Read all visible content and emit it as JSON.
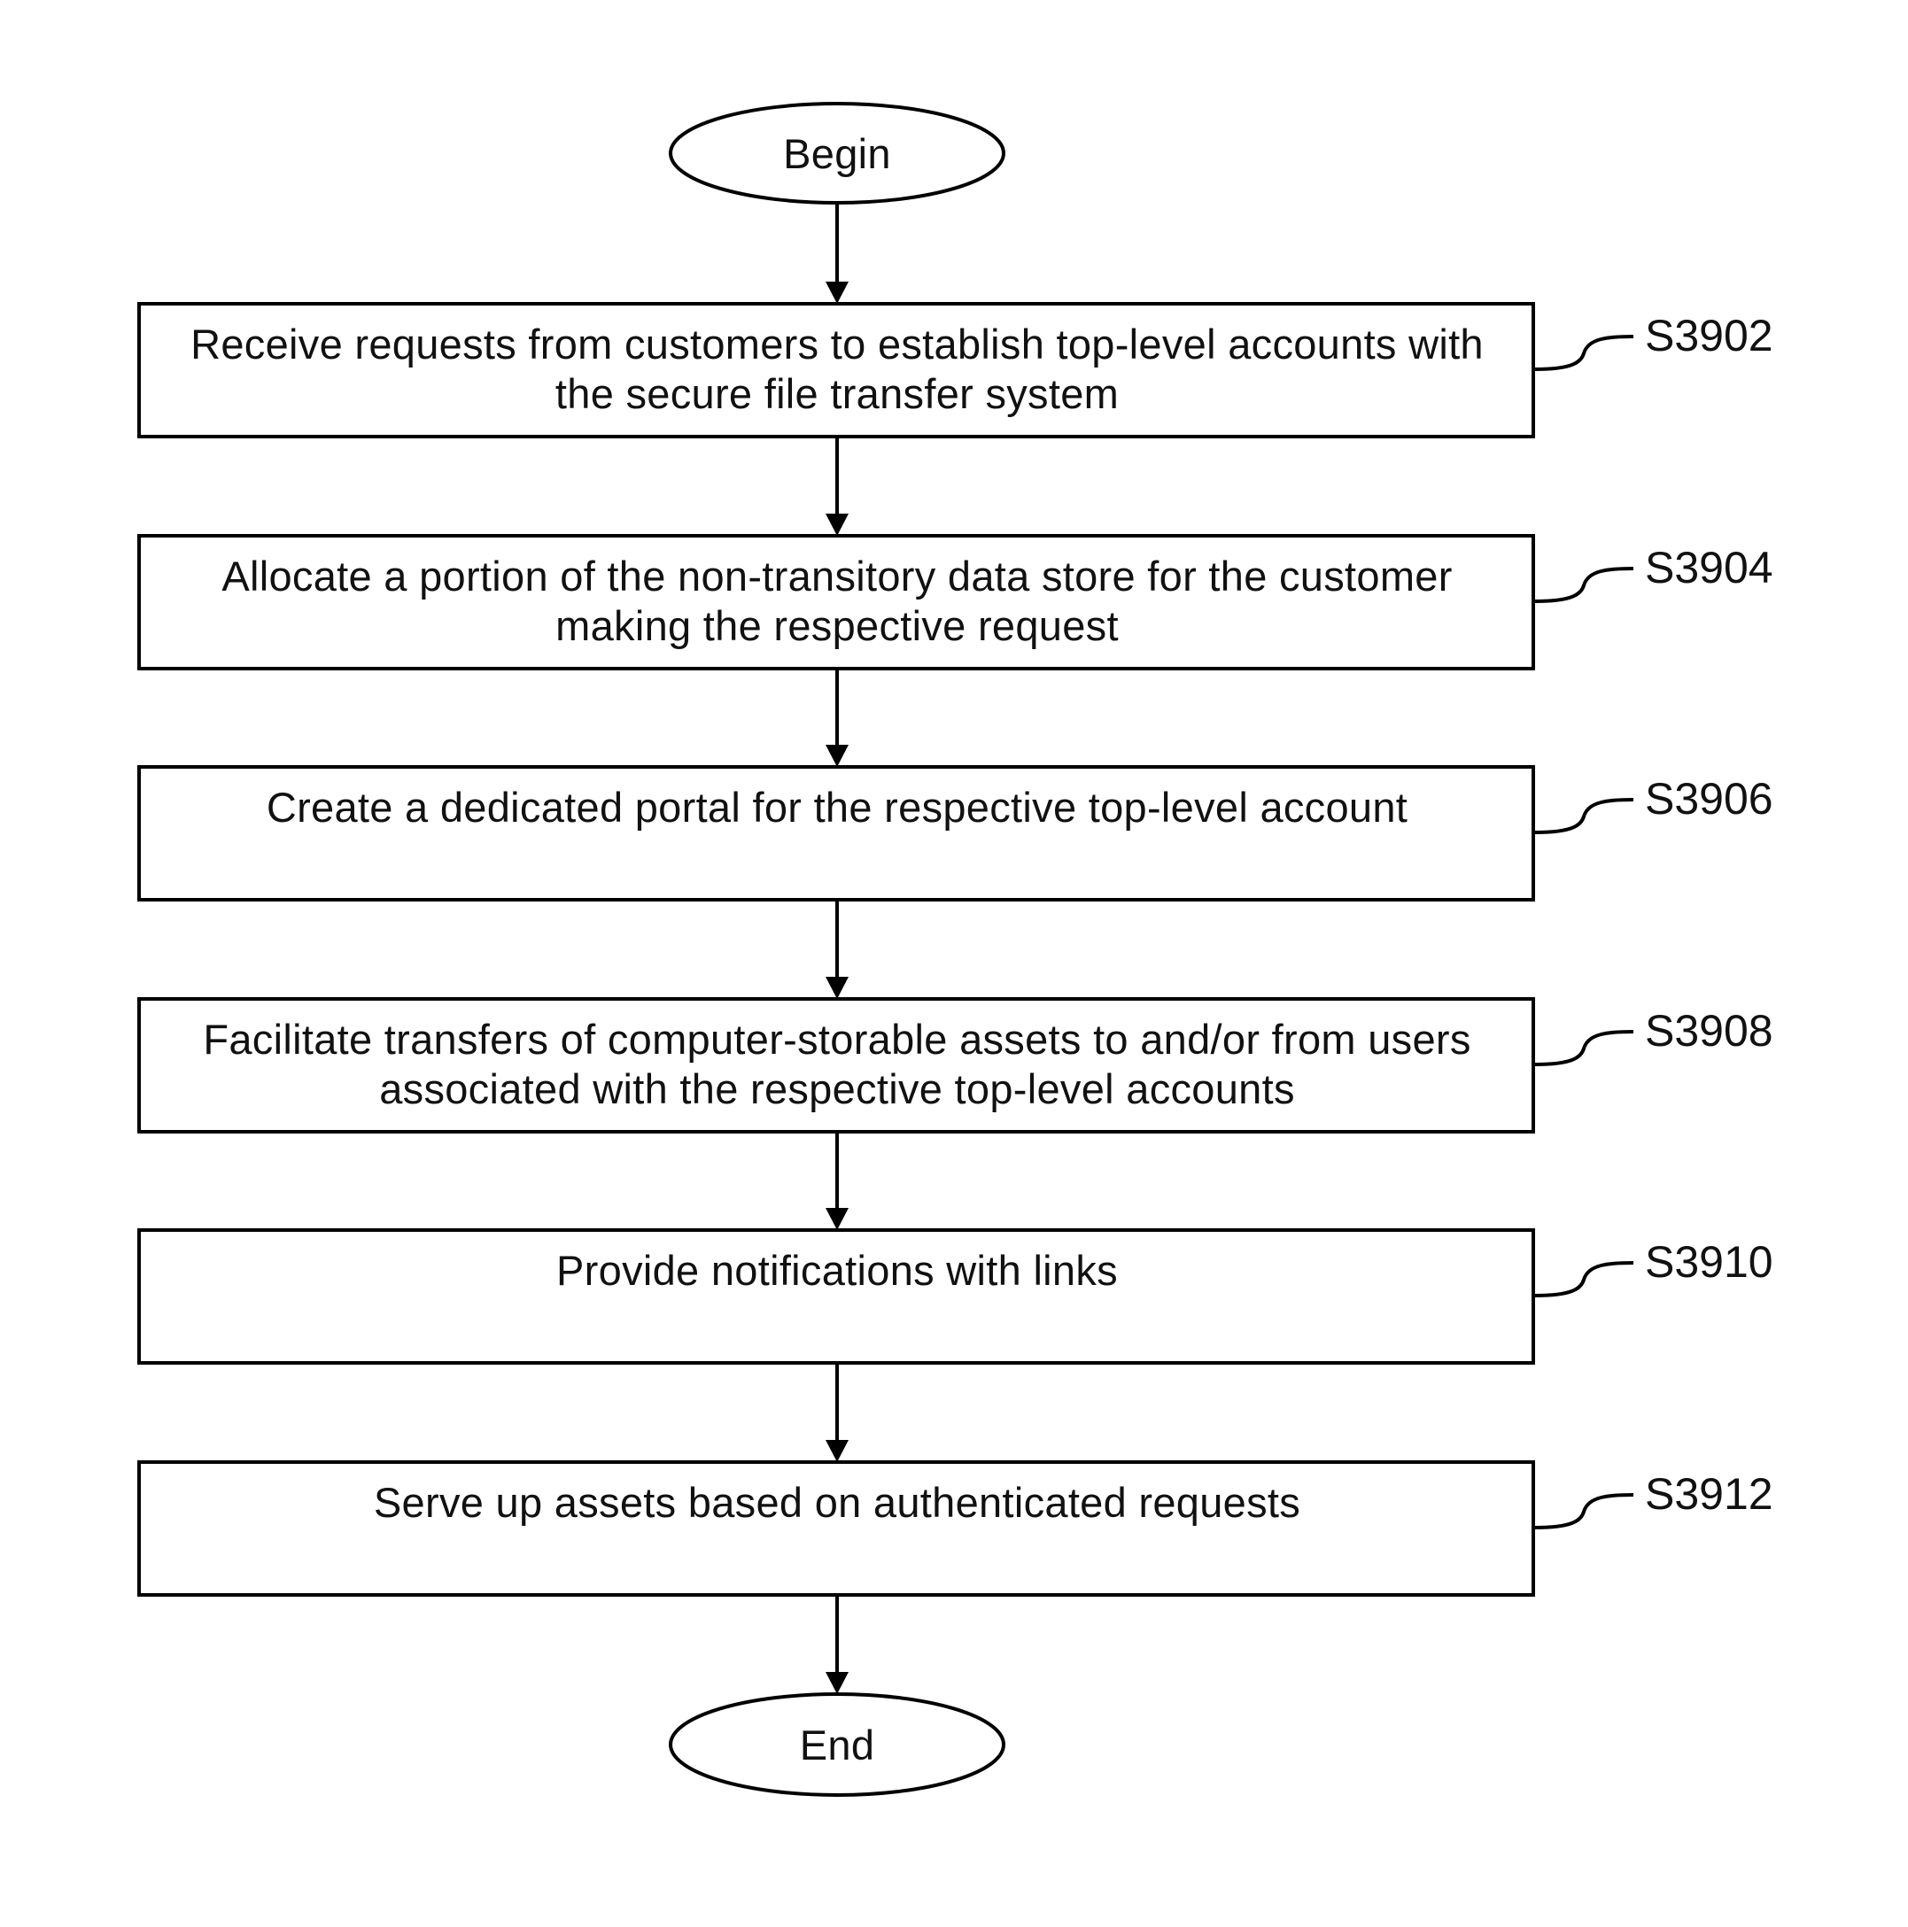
{
  "flowchart": {
    "start": {
      "label": "Begin"
    },
    "steps": [
      {
        "id": "S3902",
        "lines": [
          "Receive requests from customers to establish top-level accounts with",
          "the secure file transfer system"
        ]
      },
      {
        "id": "S3904",
        "lines": [
          "Allocate a portion of the non-transitory data store for the customer",
          "making the respective request"
        ]
      },
      {
        "id": "S3906",
        "lines": [
          "Create a dedicated portal for the respective top-level account"
        ]
      },
      {
        "id": "S3908",
        "lines": [
          "Facilitate transfers of computer-storable assets to and/or from users",
          "associated with the respective top-level accounts"
        ]
      },
      {
        "id": "S3910",
        "lines": [
          "Provide notifications with links"
        ]
      },
      {
        "id": "S3912",
        "lines": [
          "Serve up assets based on authenticated requests"
        ]
      }
    ],
    "end": {
      "label": "End"
    },
    "colors": {
      "stroke": "#000000",
      "text": "#111111",
      "background": "#ffffff"
    }
  }
}
